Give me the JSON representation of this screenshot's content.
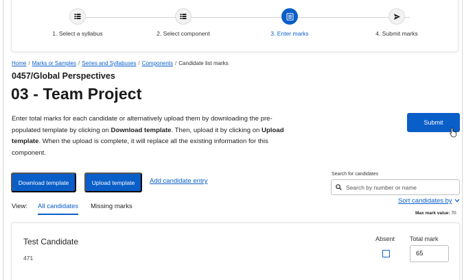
{
  "stepper": {
    "steps": [
      {
        "label": "1. Select a syllabus",
        "icon": "list-icon",
        "active": false
      },
      {
        "label": "2. Select component",
        "icon": "list-icon",
        "active": false
      },
      {
        "label": "3. Enter marks",
        "icon": "form-icon",
        "active": true
      },
      {
        "label": "4. Submit marks",
        "icon": "send-icon",
        "active": false
      }
    ]
  },
  "breadcrumb": {
    "items": [
      "Home",
      "Marks or Samples",
      "Series and Syllabuses",
      "Components"
    ],
    "current": "Candidate list marks",
    "separator": "/"
  },
  "page": {
    "code": "0457/Global Perspectives",
    "title": "03 - Team Project"
  },
  "description": {
    "part1": "Enter total marks for each candidate or alternatively upload them by downloading the pre-populated template by clicking on ",
    "bold1": "Download template",
    "part2": ". Then, upload it by clicking on ",
    "bold2": "Upload template",
    "part3": ". When the upload is complete, it will replace all the existing information for this component."
  },
  "actions": {
    "submit_label": "Submit",
    "download_label": "Download template",
    "upload_label": "Upload template",
    "add_entry_label": "Add candidate entry"
  },
  "search": {
    "label": "Search for candidates",
    "placeholder": "Search by number or name"
  },
  "view": {
    "label": "View:",
    "tabs": [
      {
        "label": "All candidates",
        "active": true
      },
      {
        "label": "Missing marks",
        "active": false
      }
    ]
  },
  "sort": {
    "label": "Sort candidates by"
  },
  "max_mark": {
    "label": "Max mark value:",
    "value": "70"
  },
  "candidate": {
    "name": "Test Candidate",
    "number": "471",
    "absent_label": "Absent",
    "absent": false,
    "total_label": "Total mark",
    "total_value": "65"
  },
  "colors": {
    "primary": "#0a5ec8",
    "text": "#1a1a1a",
    "border": "#bfbfbf"
  }
}
